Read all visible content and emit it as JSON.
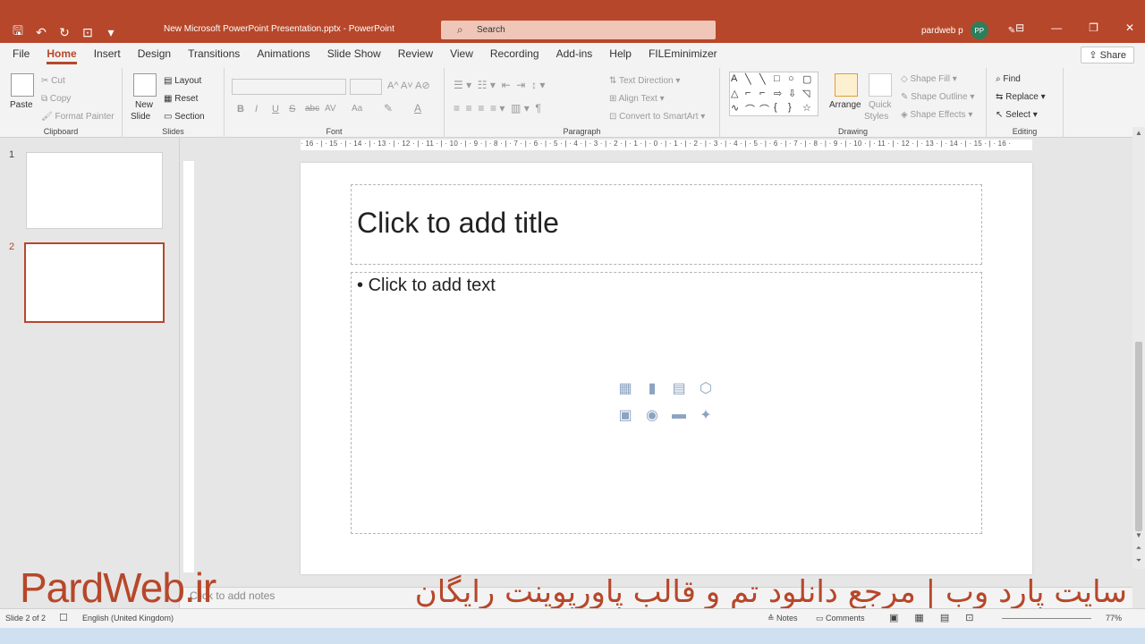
{
  "titlebar": {
    "doc_title": "New Microsoft PowerPoint Presentation.pptx  -  PowerPoint",
    "search_placeholder": "Search",
    "user_name": "pardweb p",
    "avatar_initials": "PP"
  },
  "tabs": [
    "File",
    "Home",
    "Insert",
    "Design",
    "Transitions",
    "Animations",
    "Slide Show",
    "Review",
    "View",
    "Recording",
    "Add-ins",
    "Help",
    "FILEminimizer"
  ],
  "active_tab": "Home",
  "share_label": "Share",
  "ribbon": {
    "clipboard": {
      "paste": "Paste",
      "cut": "Cut",
      "copy": "Copy",
      "format_painter": "Format Painter",
      "label": "Clipboard"
    },
    "slides": {
      "new_slide_1": "New",
      "new_slide_2": "Slide",
      "layout": "Layout",
      "reset": "Reset",
      "section": "Section",
      "label": "Slides"
    },
    "font": {
      "bold": "B",
      "italic": "I",
      "underline": "U",
      "strike": "S",
      "abc": "abc",
      "spacing": "AV",
      "case": "Aa",
      "label": "Font"
    },
    "paragraph": {
      "text_direction": "Text Direction",
      "align_text": "Align Text",
      "smartart": "Convert to SmartArt",
      "label": "Paragraph"
    },
    "drawing": {
      "arrange": "Arrange",
      "quick_styles_1": "Quick",
      "quick_styles_2": "Styles",
      "shape_fill": "Shape Fill",
      "shape_outline": "Shape Outline",
      "shape_effects": "Shape Effects",
      "label": "Drawing"
    },
    "editing": {
      "find": "Find",
      "replace": "Replace",
      "select": "Select",
      "label": "Editing"
    }
  },
  "thumbnails": [
    {
      "number": "1"
    },
    {
      "number": "2"
    }
  ],
  "slide": {
    "title_placeholder": "Click to add title",
    "body_placeholder": "Click to add text"
  },
  "notes_placeholder": "Click to add notes",
  "ruler_ticks": "· 16 · | · 15 · | · 14 · | · 13 · | · 12 · | · 11 · | · 10 · | · 9 · | · 8 · | · 7 · | · 6 · | · 5 · | · 4 · | · 3 · | · 2 · | · 1 · | · 0 · | · 1 · | · 2 · | · 3 · | · 4 · | · 5 · | · 6 · | · 7 · | · 8 · | · 9 · | · 10 · | · 11 · | · 12 · | · 13 · | · 14 · | · 15 · | · 16 ·",
  "watermark": {
    "latin": "PardWeb.ir",
    "persian": "سایت پارد وب | مرجع دانلود تم و قالب پاورپوینت رایگان"
  },
  "status": {
    "slide_count": "Slide 2 of 2",
    "language": "English (United Kingdom)",
    "notes": "Notes",
    "comments": "Comments",
    "zoom": "77%"
  },
  "colors": {
    "accent": "#b7472a"
  }
}
